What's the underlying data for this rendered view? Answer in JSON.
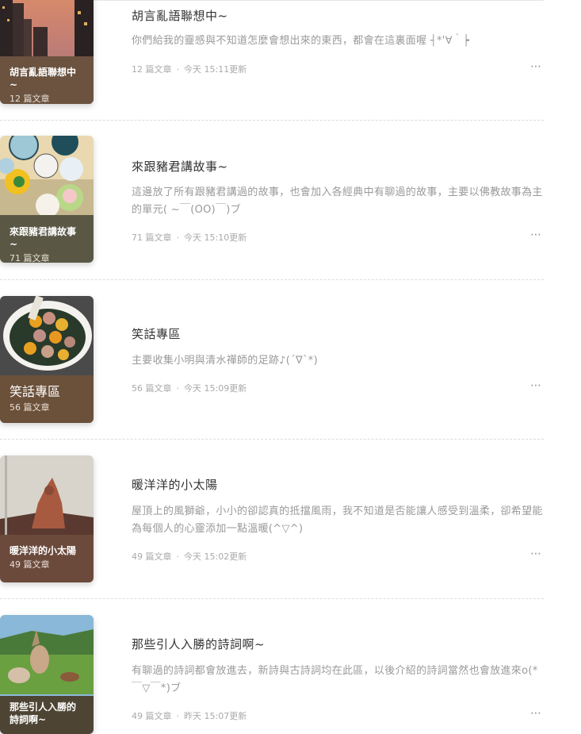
{
  "categories": [
    {
      "title": "胡言亂語聯想中~",
      "description": "你們給我的靈感與不知道怎麼會想出來的東西，都會在這裏面喔 ┤*'∀｀┝",
      "article_count": "12 篇文章",
      "updated_day": "今天",
      "updated_time": "15:11更新",
      "cover_label": "胡言亂語聯想中~",
      "cover_count": "12 篇文章",
      "band_color": "#6b5340"
    },
    {
      "title": "來跟豬君講故事~",
      "description": "這邊放了所有跟豬君講過的故事，也會加入各經典中有聊過的故事，主要以佛教故事為主的單元( ~￣(OO)￣)ブ",
      "article_count": "71 篇文章",
      "updated_day": "今天",
      "updated_time": "15:10更新",
      "cover_label": "來跟豬君講故事~",
      "cover_count": "71 篇文章",
      "band_color": "#5a5845"
    },
    {
      "title": "笑話專區",
      "description": "主要收集小明與清水禪師的足跡♪(´∇`*)",
      "article_count": "56 篇文章",
      "updated_day": "今天",
      "updated_time": "15:09更新",
      "cover_label": "笑話專區",
      "cover_count": "56 篇文章",
      "band_color": "#6b503a"
    },
    {
      "title": "暖洋洋的小太陽",
      "description": "屋頂上的風獅爺，小小的卻認真的抵擋風雨，我不知道是否能讓人感受到溫柔，卻希望能為每個人的心靈添加一點溫暖(^▽^)",
      "article_count": "49 篇文章",
      "updated_day": "今天",
      "updated_time": "15:02更新",
      "cover_label": "暖洋洋的小太陽",
      "cover_count": "49 篇文章",
      "band_color": "#6b4a3c"
    },
    {
      "title": "那些引人入勝的詩詞啊~",
      "description": "有聊過的詩詞都會放進去，新詩與古詩詞均在此區，以後介紹的詩詞當然也會放進來o(*￣▽￣*)ブ",
      "article_count": "49 篇文章",
      "updated_day": "昨天",
      "updated_time": "15:07更新",
      "cover_label": "那些引人入勝的詩詞啊~",
      "cover_count": "",
      "band_color": "#4e4434"
    }
  ],
  "separator": "·",
  "more_icon": "⋯"
}
